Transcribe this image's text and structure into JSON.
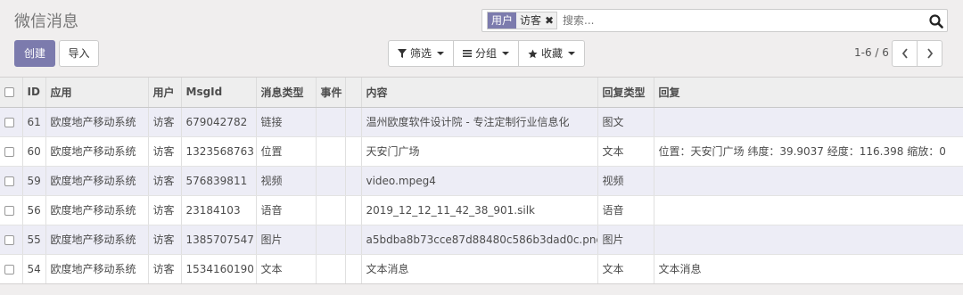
{
  "title": "微信消息",
  "search": {
    "facet_category": "用户",
    "facet_value": "访客",
    "facet_remove": "✖",
    "placeholder": "搜索..."
  },
  "buttons": {
    "create": "创建",
    "import": "导入"
  },
  "filters": {
    "filter": "筛选",
    "group": "分组",
    "favorites": "收藏"
  },
  "pager": {
    "value": "1-6 / 6"
  },
  "table": {
    "headers": [
      "ID",
      "应用",
      "用户",
      "MsgId",
      "消息类型",
      "事件",
      "内容",
      "回复类型",
      "回复"
    ],
    "rows": [
      [
        "61",
        "欧度地产移动系统",
        "访客",
        "679042782",
        "链接",
        "",
        "温州欧度软件设计院 - 专注定制行业信息化",
        "图文",
        ""
      ],
      [
        "60",
        "欧度地产移动系统",
        "访客",
        "1323568763",
        "位置",
        "",
        "天安门广场",
        "文本",
        "位置：天安门广场 纬度：39.9037 经度：116.398 缩放：0"
      ],
      [
        "59",
        "欧度地产移动系统",
        "访客",
        "576839811",
        "视频",
        "",
        "video.mpeg4",
        "视频",
        ""
      ],
      [
        "56",
        "欧度地产移动系统",
        "访客",
        "23184103",
        "语音",
        "",
        "2019_12_12_11_42_38_901.silk",
        "语音",
        ""
      ],
      [
        "55",
        "欧度地产移动系统",
        "访客",
        "1385707547",
        "图片",
        "",
        "a5bdba8b73cce87d88480c586b3dad0c.png",
        "图片",
        ""
      ],
      [
        "54",
        "欧度地产移动系统",
        "访客",
        "1534160190",
        "文本",
        "",
        "文本消息",
        "文本",
        "文本消息"
      ]
    ]
  },
  "colors": {
    "brand": "#7c7bad",
    "odd_row": "#ededf6",
    "header_bg": "#f0eeee"
  }
}
